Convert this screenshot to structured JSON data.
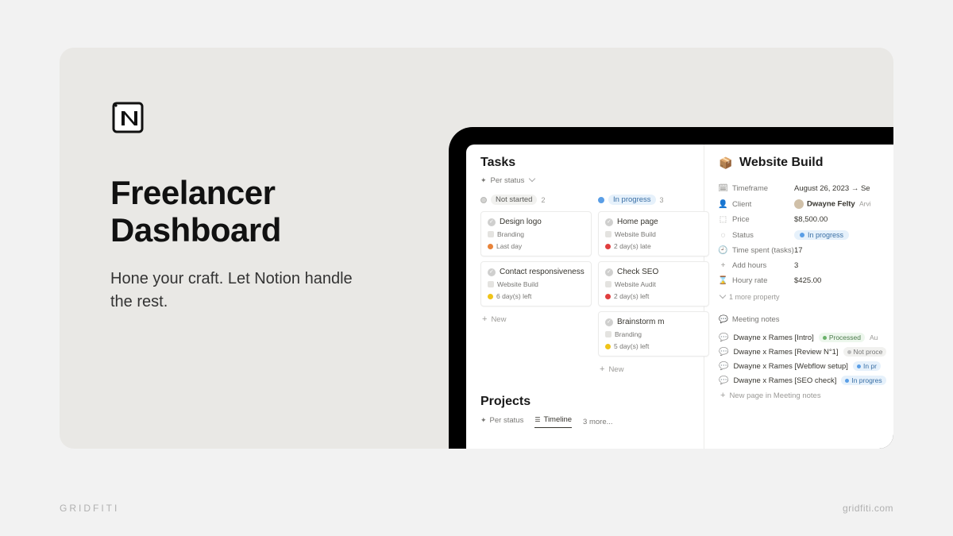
{
  "promo": {
    "headline": "Freelancer Dashboard",
    "tagline": "Hone your craft. Let Notion handle the rest."
  },
  "tasks": {
    "title": "Tasks",
    "view": "Per status",
    "columns": [
      {
        "label": "Not started",
        "count": "2",
        "style": "not-started",
        "cards": [
          {
            "title": "Design logo",
            "project": "Branding",
            "due_color": "orange",
            "due_text": "Last day"
          },
          {
            "title": "Contact responsiveness",
            "project": "Website Build",
            "due_color": "yellow",
            "due_text": "6 day(s) left"
          }
        ]
      },
      {
        "label": "In progress",
        "count": "3",
        "style": "in-progress",
        "cards": [
          {
            "title": "Home page",
            "project": "Website Build",
            "due_color": "red",
            "due_text": "2 day(s) late"
          },
          {
            "title": "Check SEO",
            "project": "Website Audit",
            "due_color": "red",
            "due_text": "2 day(s) left"
          },
          {
            "title": "Brainstorm m",
            "project": "Branding",
            "due_color": "yellow",
            "due_text": "5 day(s) left"
          }
        ]
      }
    ],
    "new_label": "New"
  },
  "projects": {
    "title": "Projects",
    "tabs": [
      "Per status",
      "Timeline"
    ],
    "more_tabs": "3 more..."
  },
  "detail": {
    "title": "Website Build",
    "props": [
      {
        "icon": "calendar",
        "label": "Timeframe",
        "value": "August 26, 2023 → Se"
      },
      {
        "icon": "person",
        "label": "Client",
        "value": "Dwayne Felty",
        "extra": "Arvi"
      },
      {
        "icon": "price",
        "label": "Price",
        "value": "$8,500.00"
      },
      {
        "icon": "status",
        "label": "Status",
        "value": "In progress",
        "pill": true
      },
      {
        "icon": "clock",
        "label": "Time spent (tasks)",
        "value": "17"
      },
      {
        "icon": "plus",
        "label": "Add hours",
        "value": "3"
      },
      {
        "icon": "hourglass",
        "label": "Houry rate",
        "value": "$425.00"
      }
    ],
    "more_property": "1 more property",
    "meeting_notes": {
      "title": "Meeting notes",
      "items": [
        {
          "name": "Dwayne x Rames [Intro]",
          "status": "Processed",
          "status_class": "processed",
          "extra": "Au"
        },
        {
          "name": "Dwayne x Rames [Review N°1]",
          "status": "Not proce",
          "status_class": "not-processed"
        },
        {
          "name": "Dwayne x Rames [Webflow setup]",
          "status": "In pr",
          "status_class": "in-progress"
        },
        {
          "name": "Dwayne x Rames [SEO check]",
          "status": "In progres",
          "status_class": "in-progress"
        }
      ],
      "new_page": "New page in Meeting notes"
    }
  },
  "footer": {
    "left": "GRIDFITI",
    "right": "gridfiti.com"
  }
}
